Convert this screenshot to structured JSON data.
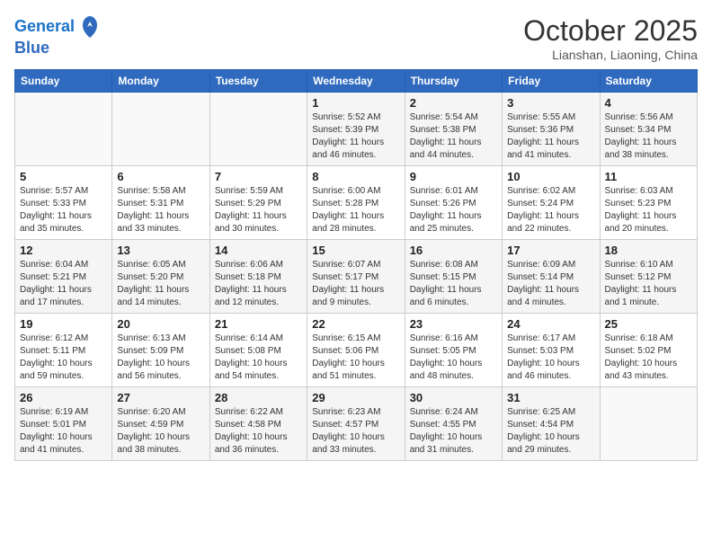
{
  "header": {
    "logo_line1": "General",
    "logo_line2": "Blue",
    "month_title": "October 2025",
    "location": "Lianshan, Liaoning, China"
  },
  "weekdays": [
    "Sunday",
    "Monday",
    "Tuesday",
    "Wednesday",
    "Thursday",
    "Friday",
    "Saturday"
  ],
  "weeks": [
    [
      {
        "day": "",
        "info": ""
      },
      {
        "day": "",
        "info": ""
      },
      {
        "day": "",
        "info": ""
      },
      {
        "day": "1",
        "info": "Sunrise: 5:52 AM\nSunset: 5:39 PM\nDaylight: 11 hours\nand 46 minutes."
      },
      {
        "day": "2",
        "info": "Sunrise: 5:54 AM\nSunset: 5:38 PM\nDaylight: 11 hours\nand 44 minutes."
      },
      {
        "day": "3",
        "info": "Sunrise: 5:55 AM\nSunset: 5:36 PM\nDaylight: 11 hours\nand 41 minutes."
      },
      {
        "day": "4",
        "info": "Sunrise: 5:56 AM\nSunset: 5:34 PM\nDaylight: 11 hours\nand 38 minutes."
      }
    ],
    [
      {
        "day": "5",
        "info": "Sunrise: 5:57 AM\nSunset: 5:33 PM\nDaylight: 11 hours\nand 35 minutes."
      },
      {
        "day": "6",
        "info": "Sunrise: 5:58 AM\nSunset: 5:31 PM\nDaylight: 11 hours\nand 33 minutes."
      },
      {
        "day": "7",
        "info": "Sunrise: 5:59 AM\nSunset: 5:29 PM\nDaylight: 11 hours\nand 30 minutes."
      },
      {
        "day": "8",
        "info": "Sunrise: 6:00 AM\nSunset: 5:28 PM\nDaylight: 11 hours\nand 28 minutes."
      },
      {
        "day": "9",
        "info": "Sunrise: 6:01 AM\nSunset: 5:26 PM\nDaylight: 11 hours\nand 25 minutes."
      },
      {
        "day": "10",
        "info": "Sunrise: 6:02 AM\nSunset: 5:24 PM\nDaylight: 11 hours\nand 22 minutes."
      },
      {
        "day": "11",
        "info": "Sunrise: 6:03 AM\nSunset: 5:23 PM\nDaylight: 11 hours\nand 20 minutes."
      }
    ],
    [
      {
        "day": "12",
        "info": "Sunrise: 6:04 AM\nSunset: 5:21 PM\nDaylight: 11 hours\nand 17 minutes."
      },
      {
        "day": "13",
        "info": "Sunrise: 6:05 AM\nSunset: 5:20 PM\nDaylight: 11 hours\nand 14 minutes."
      },
      {
        "day": "14",
        "info": "Sunrise: 6:06 AM\nSunset: 5:18 PM\nDaylight: 11 hours\nand 12 minutes."
      },
      {
        "day": "15",
        "info": "Sunrise: 6:07 AM\nSunset: 5:17 PM\nDaylight: 11 hours\nand 9 minutes."
      },
      {
        "day": "16",
        "info": "Sunrise: 6:08 AM\nSunset: 5:15 PM\nDaylight: 11 hours\nand 6 minutes."
      },
      {
        "day": "17",
        "info": "Sunrise: 6:09 AM\nSunset: 5:14 PM\nDaylight: 11 hours\nand 4 minutes."
      },
      {
        "day": "18",
        "info": "Sunrise: 6:10 AM\nSunset: 5:12 PM\nDaylight: 11 hours\nand 1 minute."
      }
    ],
    [
      {
        "day": "19",
        "info": "Sunrise: 6:12 AM\nSunset: 5:11 PM\nDaylight: 10 hours\nand 59 minutes."
      },
      {
        "day": "20",
        "info": "Sunrise: 6:13 AM\nSunset: 5:09 PM\nDaylight: 10 hours\nand 56 minutes."
      },
      {
        "day": "21",
        "info": "Sunrise: 6:14 AM\nSunset: 5:08 PM\nDaylight: 10 hours\nand 54 minutes."
      },
      {
        "day": "22",
        "info": "Sunrise: 6:15 AM\nSunset: 5:06 PM\nDaylight: 10 hours\nand 51 minutes."
      },
      {
        "day": "23",
        "info": "Sunrise: 6:16 AM\nSunset: 5:05 PM\nDaylight: 10 hours\nand 48 minutes."
      },
      {
        "day": "24",
        "info": "Sunrise: 6:17 AM\nSunset: 5:03 PM\nDaylight: 10 hours\nand 46 minutes."
      },
      {
        "day": "25",
        "info": "Sunrise: 6:18 AM\nSunset: 5:02 PM\nDaylight: 10 hours\nand 43 minutes."
      }
    ],
    [
      {
        "day": "26",
        "info": "Sunrise: 6:19 AM\nSunset: 5:01 PM\nDaylight: 10 hours\nand 41 minutes."
      },
      {
        "day": "27",
        "info": "Sunrise: 6:20 AM\nSunset: 4:59 PM\nDaylight: 10 hours\nand 38 minutes."
      },
      {
        "day": "28",
        "info": "Sunrise: 6:22 AM\nSunset: 4:58 PM\nDaylight: 10 hours\nand 36 minutes."
      },
      {
        "day": "29",
        "info": "Sunrise: 6:23 AM\nSunset: 4:57 PM\nDaylight: 10 hours\nand 33 minutes."
      },
      {
        "day": "30",
        "info": "Sunrise: 6:24 AM\nSunset: 4:55 PM\nDaylight: 10 hours\nand 31 minutes."
      },
      {
        "day": "31",
        "info": "Sunrise: 6:25 AM\nSunset: 4:54 PM\nDaylight: 10 hours\nand 29 minutes."
      },
      {
        "day": "",
        "info": ""
      }
    ]
  ]
}
